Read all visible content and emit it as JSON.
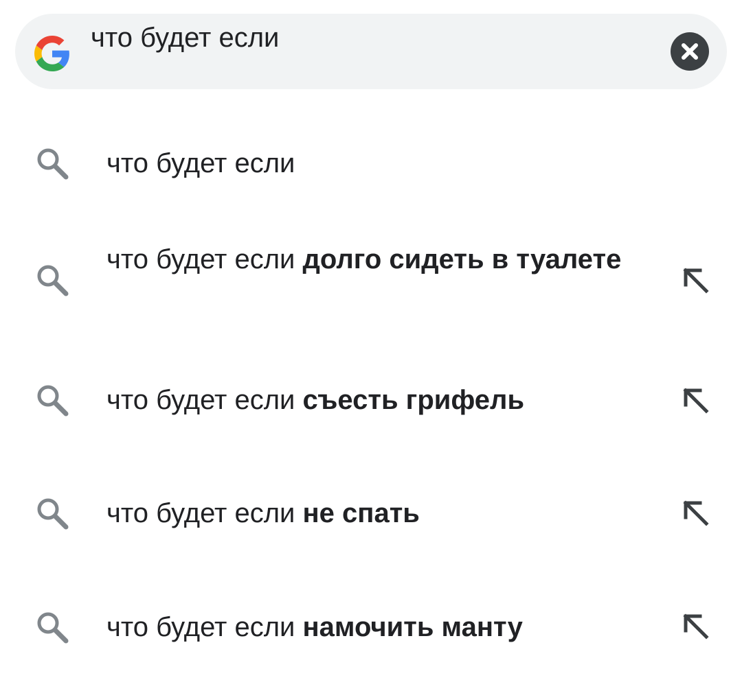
{
  "search": {
    "query": "что будет если"
  },
  "icons": {
    "logo": "google-g-icon",
    "clear": "close-circle-icon",
    "suggestion": "search-icon",
    "fill": "arrow-up-left-icon"
  },
  "colors": {
    "bar_background": "#f1f3f4",
    "text": "#202124",
    "icon_gray": "#80868b",
    "clear_button": "#3c4043",
    "google_blue": "#4285F4",
    "google_red": "#EA4335",
    "google_yellow": "#FBBC05",
    "google_green": "#34A853"
  },
  "suggestions": [
    {
      "prefix": "что будет если",
      "completion": ""
    },
    {
      "prefix": "что будет если ",
      "completion": "долго сидеть в туалете"
    },
    {
      "prefix": "что будет если ",
      "completion": "съесть грифель"
    },
    {
      "prefix": "что будет если ",
      "completion": "не спать"
    },
    {
      "prefix": "что будет если ",
      "completion": "намочить манту"
    }
  ]
}
